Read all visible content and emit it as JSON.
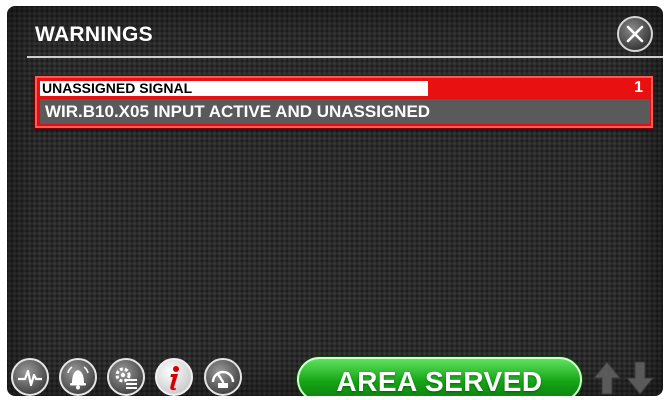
{
  "header": {
    "title": "WARNINGS"
  },
  "warnings": [
    {
      "name": "UNASSIGNED SIGNAL",
      "count": "1",
      "detail": "WIR.B10.X05 INPUT ACTIVE AND UNASSIGNED"
    }
  ],
  "footer": {
    "area_button_label": "AREA SERVED",
    "icons": [
      "pulse-icon",
      "alarm-bell-icon",
      "settings-list-icon",
      "info-icon",
      "gauge-icon",
      "arrow-up-icon",
      "arrow-down-icon"
    ]
  },
  "colors": {
    "warning_red": "#e81010",
    "area_green": "#15a515",
    "info_red": "#d40000"
  }
}
